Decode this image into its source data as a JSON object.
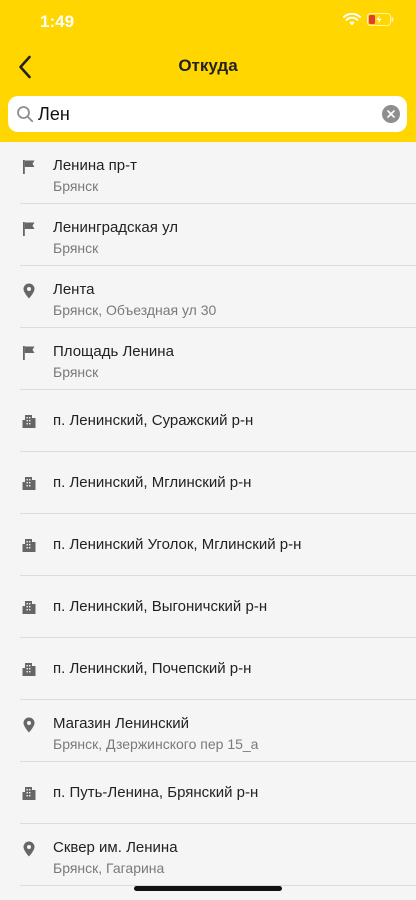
{
  "status": {
    "time": "1:49",
    "accent": "#ffd600"
  },
  "nav": {
    "title": "Откуда",
    "back_icon": "chevron-left-icon"
  },
  "search": {
    "value": "Лен",
    "placeholder": ""
  },
  "results": [
    {
      "icon": "flag-icon",
      "title": "Ленина пр-т",
      "subtitle": "Брянск"
    },
    {
      "icon": "flag-icon",
      "title": "Ленинградская ул",
      "subtitle": "Брянск"
    },
    {
      "icon": "pin-icon",
      "title": "Лента",
      "subtitle": "Брянск, Объездная ул 30"
    },
    {
      "icon": "flag-icon",
      "title": "Площадь Ленина",
      "subtitle": "Брянск"
    },
    {
      "icon": "building-icon",
      "title": "п. Ленинский, Суражский р-н",
      "subtitle": ""
    },
    {
      "icon": "building-icon",
      "title": "п. Ленинский, Мглинский р-н",
      "subtitle": ""
    },
    {
      "icon": "building-icon",
      "title": "п. Ленинский Уголок, Мглинский р-н",
      "subtitle": ""
    },
    {
      "icon": "building-icon",
      "title": "п. Ленинский, Выгоничский р-н",
      "subtitle": ""
    },
    {
      "icon": "building-icon",
      "title": "п. Ленинский, Почепский р-н",
      "subtitle": ""
    },
    {
      "icon": "pin-icon",
      "title": "Магазин Ленинский",
      "subtitle": "Брянск, Дзержинского пер 15_а"
    },
    {
      "icon": "building-icon",
      "title": "п. Путь-Ленина, Брянский р-н",
      "subtitle": ""
    },
    {
      "icon": "pin-icon",
      "title": "Сквер им. Ленина",
      "subtitle": "Брянск, Гагарина"
    }
  ]
}
